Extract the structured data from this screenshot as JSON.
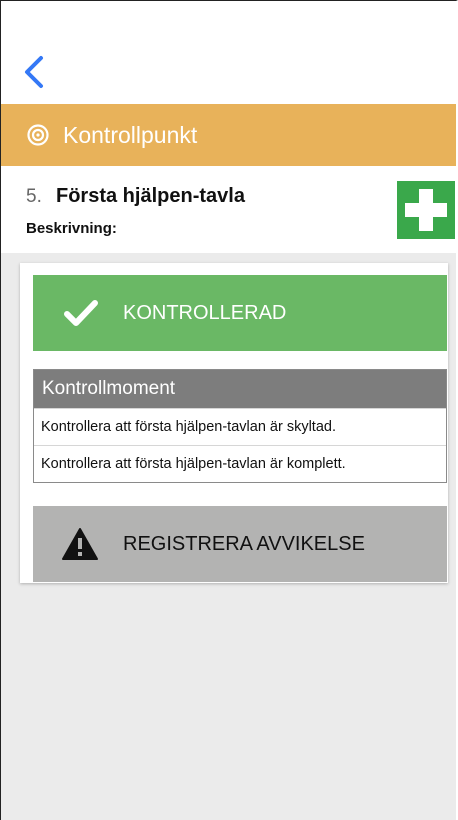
{
  "nav": {
    "back_icon": "chevron-left-icon"
  },
  "header": {
    "icon": "target-icon",
    "title": "Kontrollpunkt"
  },
  "point": {
    "number": "5.",
    "title": "Första hjälpen-tavla",
    "description_label": "Beskrivning:",
    "icon": "first-aid-icon"
  },
  "actions": {
    "checked_label": "KONTROLLERAD",
    "checked_icon": "checkmark-icon",
    "deviation_label": "REGISTRERA AVVIKELSE",
    "deviation_icon": "warning-icon"
  },
  "checklist": {
    "header": "Kontrollmoment",
    "items": [
      "Kontrollera att första hjälpen-tavlan är skyltad.",
      "Kontrollera att första hjälpen-tavlan är komplett."
    ]
  },
  "colors": {
    "header_bg": "#e8b25a",
    "checked_bg": "#6ab865",
    "deviation_bg": "#b3b3b2",
    "checklist_header_bg": "#7d7d7d",
    "back_icon": "#3478f6",
    "first_aid_green": "#3aa84b",
    "content_bg": "#ebebeb"
  }
}
